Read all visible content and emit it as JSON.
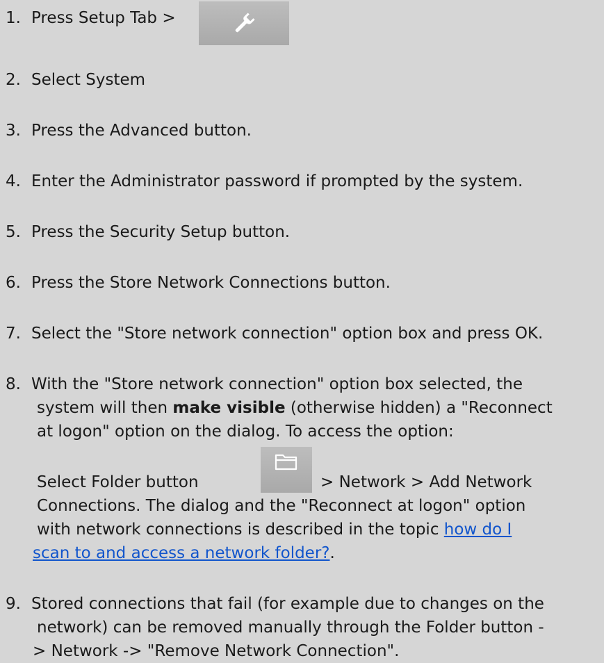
{
  "steps": [
    {
      "num": "1.",
      "text": "Press Setup Tab >"
    },
    {
      "num": "2.",
      "text": "Select System"
    },
    {
      "num": "3.",
      "text": "Press the Advanced button."
    },
    {
      "num": "4.",
      "text": "Enter the Administrator password if prompted by the system."
    },
    {
      "num": "5.",
      "text": "Press the Security Setup button."
    },
    {
      "num": "6.",
      "text": "Press the Store Network Connections button."
    },
    {
      "num": "7.",
      "text": "Select the \"Store network connection\" option box and press OK."
    },
    {
      "num": "8.",
      "line1": "With the \"Store network connection\" option box selected, the",
      "line2_pre": "system will then ",
      "line2_bold": "make visible",
      "line2_post": " (otherwise hidden) a \"Reconnect",
      "line3": "at logon\" option on the dialog. To access the option:",
      "folder_pre": "Select Folder button",
      "folder_post": "> Network > Add Network",
      "line5": "Connections. The dialog and the \"Reconnect at logon\" option",
      "line6_pre": "with network connections is described in the topic ",
      "link_part1": "how do I",
      "link_part2": " scan to and access a network folder?",
      "link_after": "."
    },
    {
      "num": "9.",
      "line1": "Stored connections that fail (for example due to changes on the",
      "line2": "network) can be removed manually through the Folder button -",
      "line3": "> Network -> \"Remove Network Connection\"."
    }
  ],
  "icons": {
    "setup": "wrench-icon",
    "folder": "folder-icon"
  }
}
